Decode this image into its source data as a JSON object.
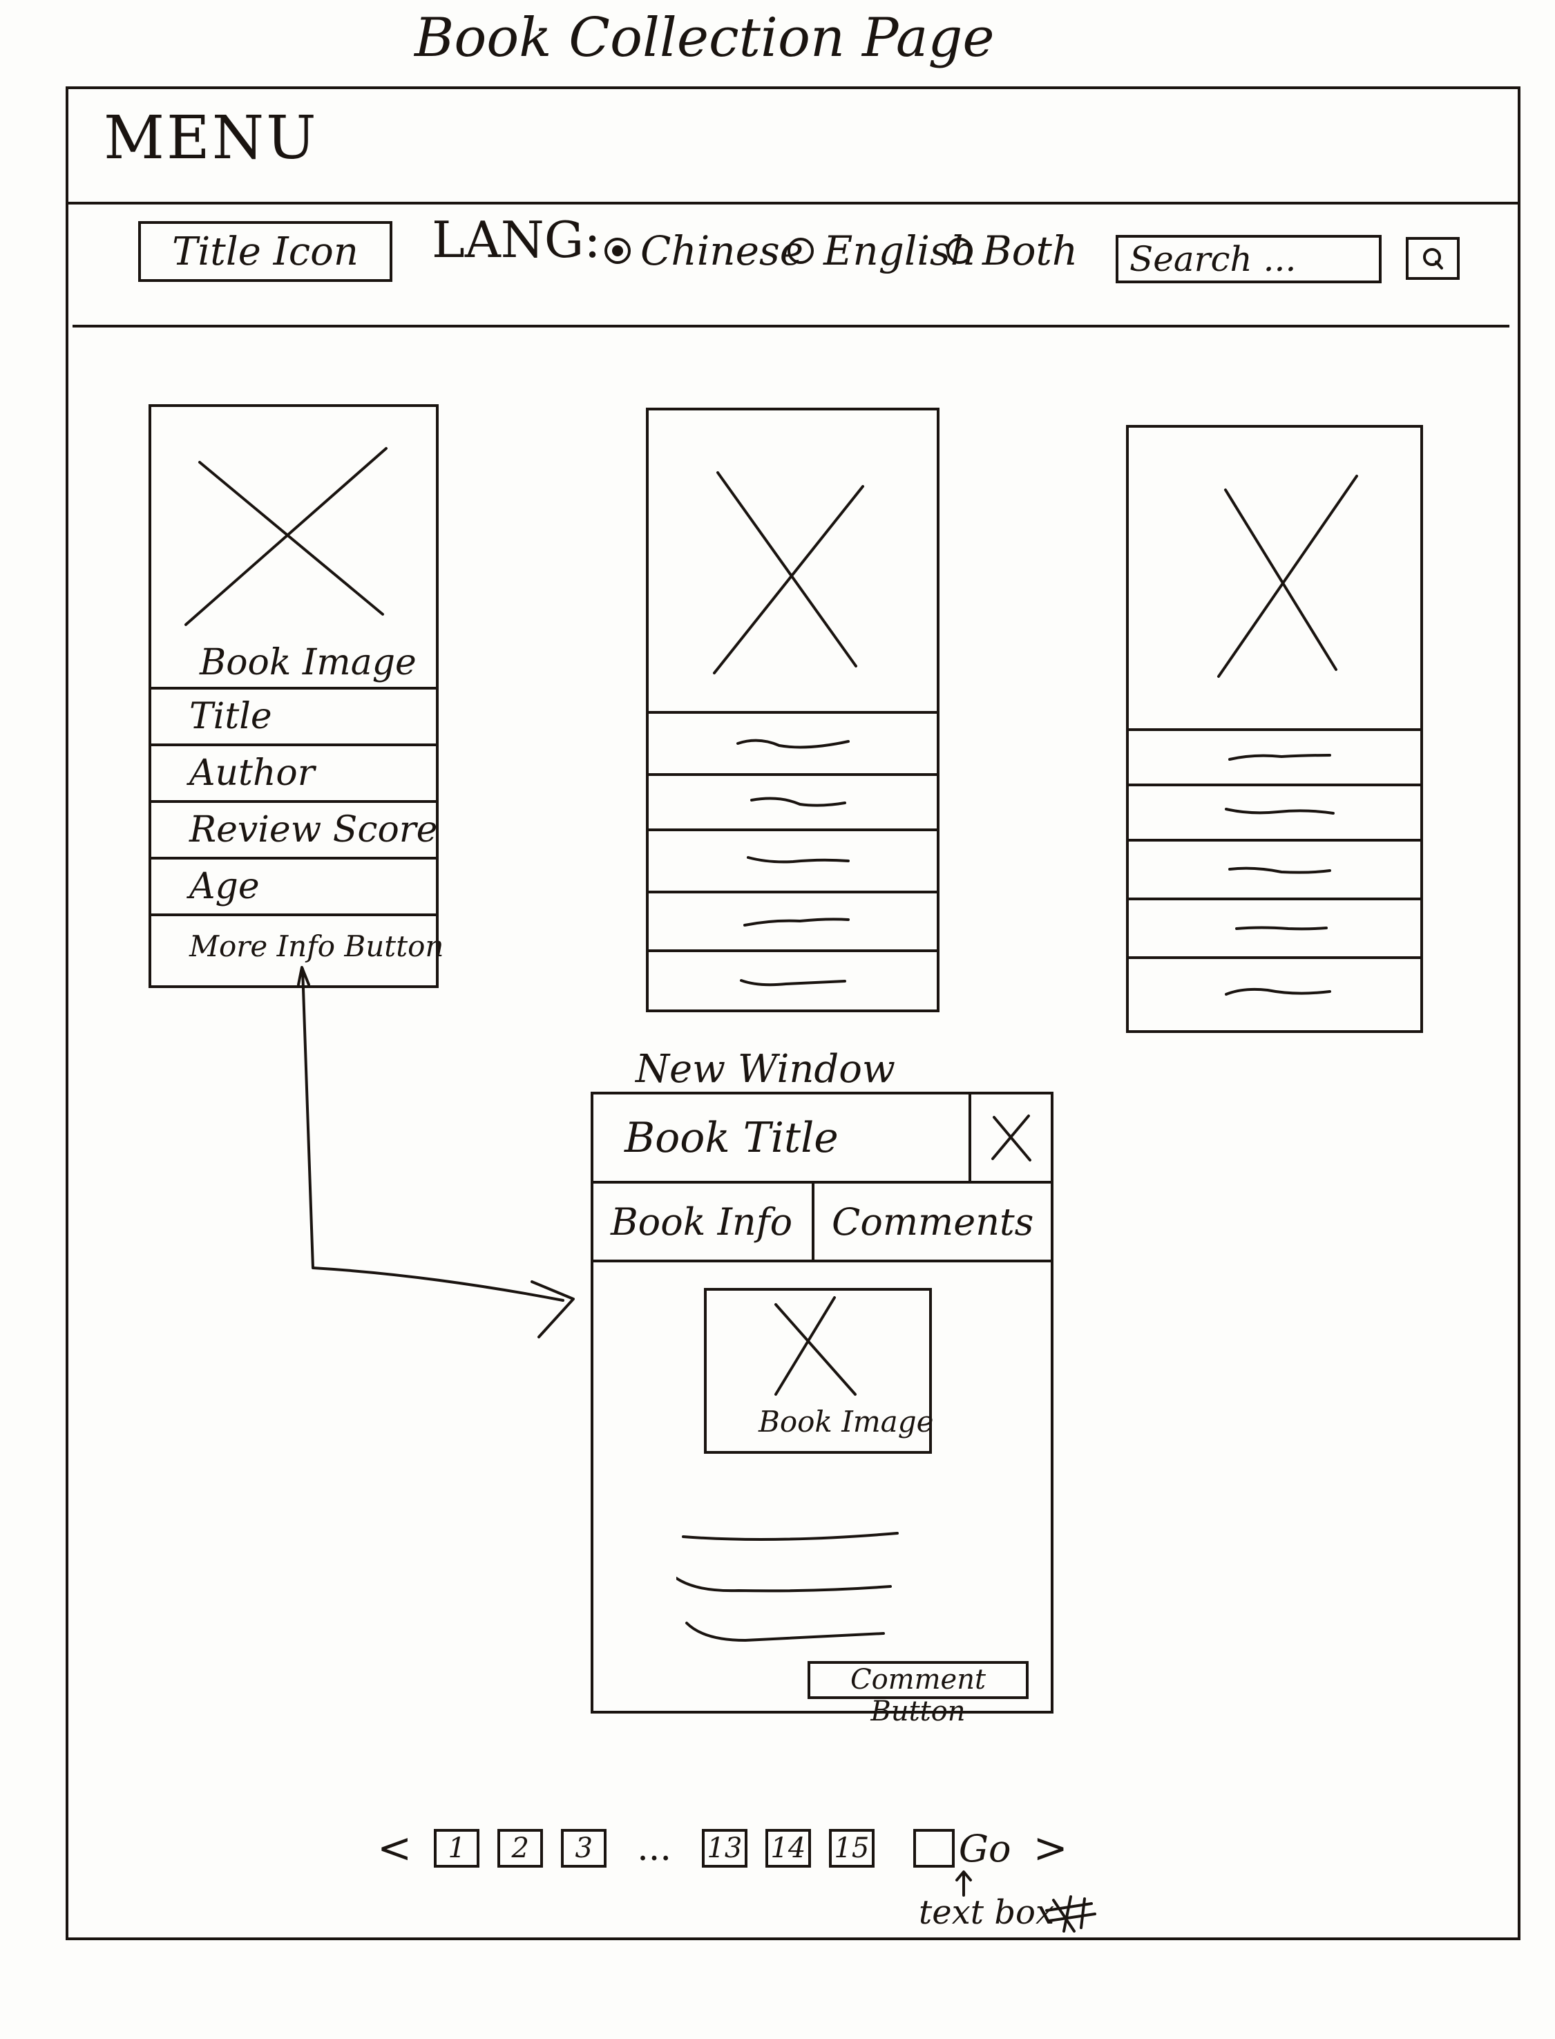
{
  "page": {
    "title": "Book Collection Page"
  },
  "menu": {
    "label": "MENU"
  },
  "header": {
    "title_icon": "Title Icon",
    "lang_label": "LANG:",
    "lang_options": [
      {
        "label": "Chinese",
        "selected": true
      },
      {
        "label": "English",
        "selected": false
      },
      {
        "label": "Both",
        "selected": false
      }
    ],
    "search": {
      "placeholder": "Search ...",
      "button_icon": "search-icon"
    }
  },
  "cards": [
    {
      "image_caption": "Book Image",
      "fields": [
        "Title",
        "Author",
        "Review Score",
        "Age",
        "More Info Button"
      ]
    },
    {
      "image_caption": "",
      "fields": [
        "",
        "",
        "",
        "",
        ""
      ]
    },
    {
      "image_caption": "",
      "fields": [
        "",
        "",
        "",
        "",
        ""
      ]
    }
  ],
  "modal": {
    "window_label": "New Window",
    "title": "Book Title",
    "close_icon": "close-icon",
    "tabs": [
      "Book Info",
      "Comments"
    ],
    "image_caption": "Book Image",
    "comment_button": "Comment Button"
  },
  "pagination": {
    "prev": "<",
    "pages": [
      "1",
      "2",
      "3",
      "13",
      "14",
      "15"
    ],
    "ellipsis": "...",
    "go": "Go",
    "next": ">",
    "note": "text box"
  }
}
